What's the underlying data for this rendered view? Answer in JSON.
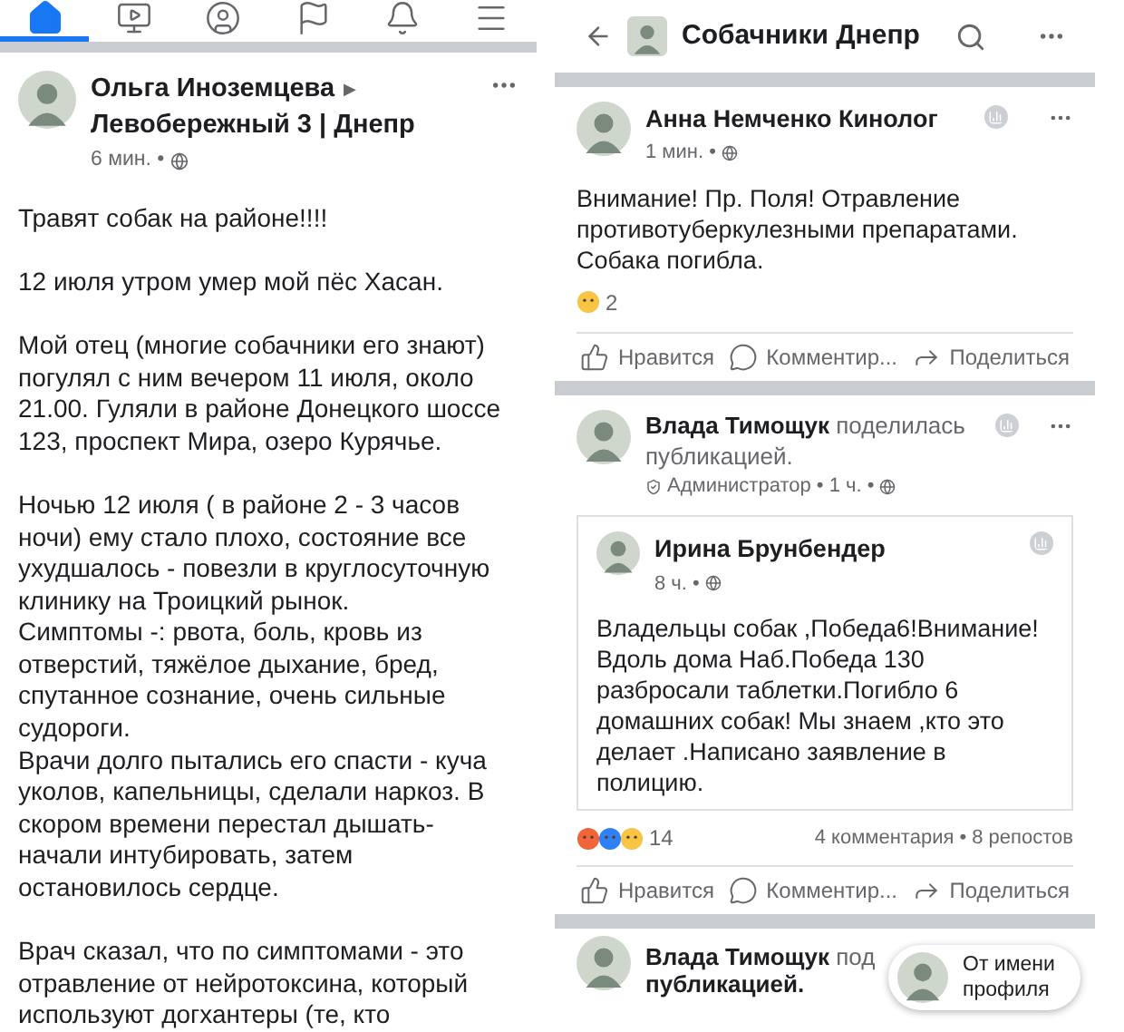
{
  "left": {
    "tabs": [
      {
        "kind": "home",
        "selected": true
      },
      {
        "kind": "video",
        "selected": false
      },
      {
        "kind": "profile",
        "selected": false
      },
      {
        "kind": "pages",
        "selected": false
      },
      {
        "kind": "notifications",
        "selected": false
      },
      {
        "kind": "menu",
        "selected": false
      }
    ],
    "post": {
      "author": "Ольга Иноземцева",
      "arrow": "▶",
      "group": "Левобережный 3 | Днепр",
      "time": "6 мин. •",
      "paragraphs": [
        [
          "Травят собак на районе!!!!"
        ],
        [
          "12 июля утром умер мой пёс Хасан."
        ],
        [
          "Мой отец (многие собачники его знают)",
          "погулял с ним вечером 11 июля, около",
          "21.00. Гуляли в районе Донецкого шоссе",
          "123, проспект Мира, озеро Курячье."
        ],
        [
          "Ночью 12 июля ( в районе 2 - 3  часов",
          "ночи) ему стало плохо, состояние все",
          "ухудшалось - повезли в круглосуточную",
          "клинику на Троицкий рынок.",
          "Симптомы -: рвота, боль, кровь из",
          "отверстий, тяжёлое дыхание, бред,",
          "спутанное сознание, очень сильные",
          "судороги.",
          "Врачи долго пытались его спасти - куча",
          "уколов, капельницы, сделали наркоз. В",
          "скором времени перестал дышать-",
          "начали интубировать, затем",
          "остановилось сердце."
        ],
        [
          "Врач сказал, что по симптомами - это",
          "отравление от нейротоксина, который",
          "используют догхантеры (те, кто"
        ]
      ]
    }
  },
  "right": {
    "header": {
      "title": "Собачники Днепр"
    },
    "post1": {
      "author": "Анна Немченко Кинолог",
      "time": "1 мин. •",
      "lines": [
        "Внимание! Пр. Поля! Отравление",
        "противотуберкулезными препаратами.",
        "Собака погибла."
      ],
      "reactions": [
        {
          "kind": "sad"
        }
      ],
      "reaction_count": "2",
      "actions": [
        {
          "kind": "like",
          "label": "Нравится"
        },
        {
          "kind": "comment",
          "label": "Комментир..."
        },
        {
          "kind": "share",
          "label": "Поделиться"
        }
      ]
    },
    "post2": {
      "sharer": "**Влада Тимощук** поделилась",
      "sharer_rest": "публикацией.",
      "meta": "Администратор • 1 ч. •",
      "shared": {
        "author": "Ирина Брунбендер",
        "time": "8 ч. •",
        "lines": [
          "Владельцы собак ,Победа6!Внимание!",
          "Вдоль дома Наб.Победа 130",
          "разбросали таблетки.Погибло 6",
          "домашних собак! Мы знаем ,кто это",
          "делает .Написано заявление в",
          "полицию."
        ]
      },
      "reactions": [
        {
          "kind": "angry"
        },
        {
          "kind": "like"
        },
        {
          "kind": "sad"
        }
      ],
      "reaction_count": "14",
      "stats": "4 комментария • 8 репостов",
      "actions": [
        {
          "kind": "like",
          "label": "Нравится"
        },
        {
          "kind": "comment",
          "label": "Комментир..."
        },
        {
          "kind": "share",
          "label": "Поделиться"
        }
      ]
    },
    "post3": {
      "sharer": "**Влада Тимощук** под",
      "sharer_rest": "публикацией."
    },
    "identity_pill": {
      "lines": [
        "От имени",
        "профиля"
      ]
    }
  }
}
